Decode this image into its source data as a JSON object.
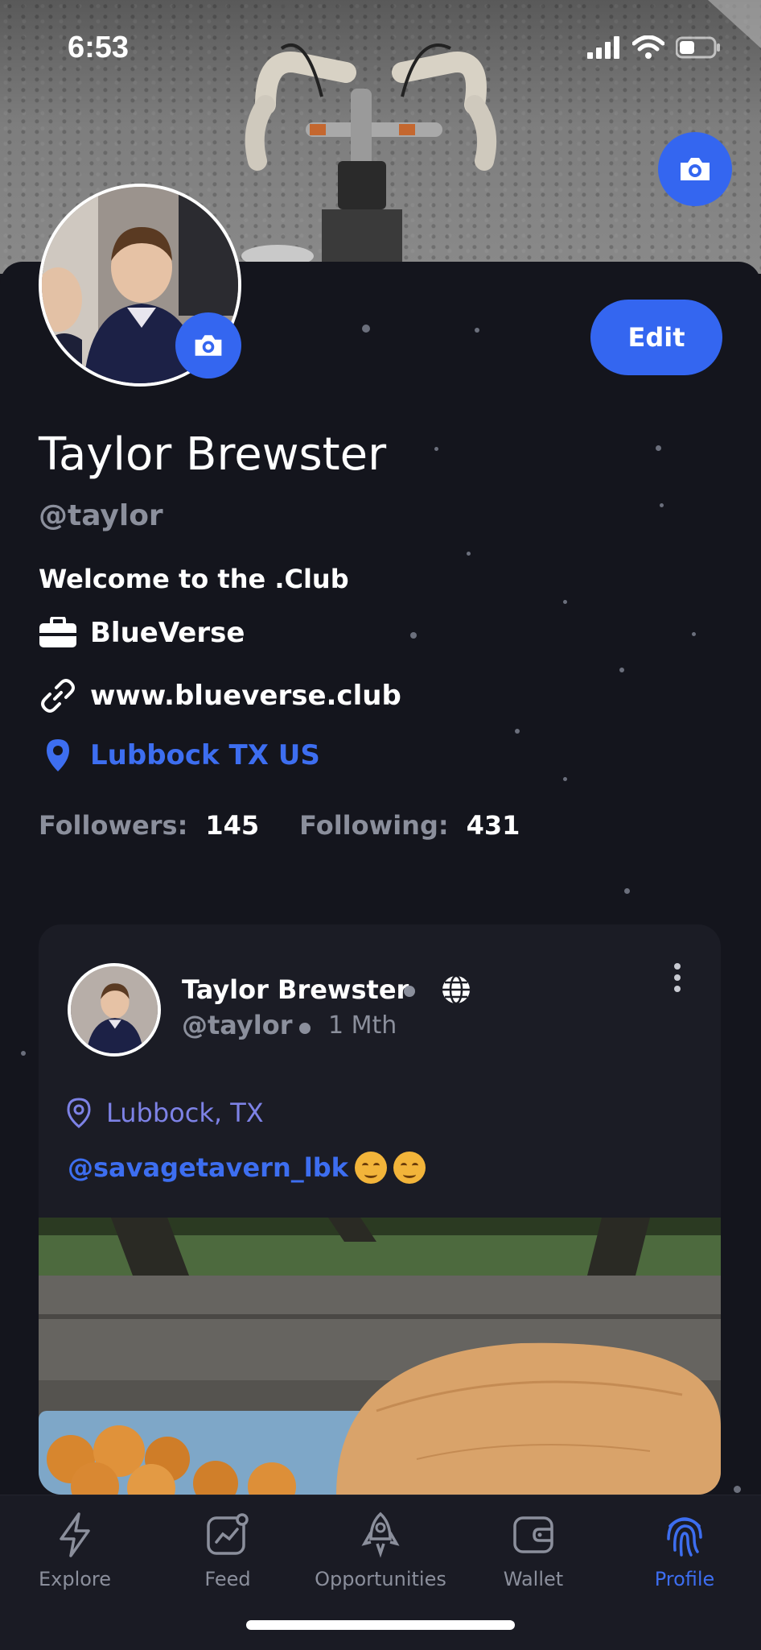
{
  "status_bar": {
    "time": "6:53"
  },
  "profile": {
    "name": "Taylor Brewster",
    "handle": "@taylor",
    "bio": "Welcome to the .Club",
    "company": "BlueVerse",
    "website": "www.blueverse.club",
    "location": "Lubbock TX US",
    "edit_label": "Edit",
    "stats": {
      "followers_label": "Followers:",
      "followers_value": "145",
      "following_label": "Following:",
      "following_value": "431"
    }
  },
  "post": {
    "author": "Taylor Brewster",
    "handle": "@taylor",
    "time": "1 Mth",
    "location": "Lubbock, TX",
    "text": "@savagetavern_lbk",
    "emoji_count": 2
  },
  "tabs": [
    {
      "label": "Explore",
      "icon": "lightning-icon",
      "active": false
    },
    {
      "label": "Feed",
      "icon": "chart-icon",
      "active": false
    },
    {
      "label": "Opportunities",
      "icon": "rocket-icon",
      "active": false
    },
    {
      "label": "Wallet",
      "icon": "wallet-icon",
      "active": false
    },
    {
      "label": "Profile",
      "icon": "fingerprint-icon",
      "active": true
    }
  ],
  "colors": {
    "accent": "#3466f0",
    "link": "#3d6ef0",
    "background": "#14151d",
    "muted": "#8b8f9c",
    "location_pin": "#7d82e6"
  }
}
